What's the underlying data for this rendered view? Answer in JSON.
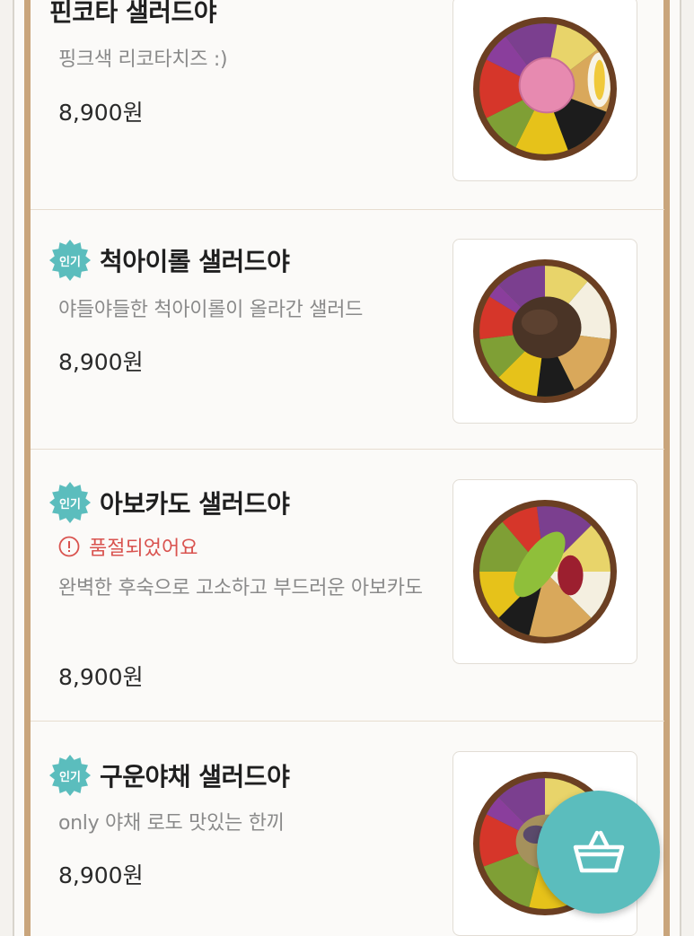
{
  "menu": {
    "items": [
      {
        "name": "핀코타 샐러드야",
        "badge": "",
        "sold_out": "",
        "desc": "핑크색 리코타치즈 :)",
        "price": "8,900원",
        "image": "salad-bowl-ricotta"
      },
      {
        "name": "척아이롤 샐러드야",
        "badge": "인기",
        "sold_out": "",
        "desc": "야들야들한 척아이롤이 올라간 샐러드",
        "price": "8,900원",
        "image": "salad-bowl-beef"
      },
      {
        "name": "아보카도 샐러드야",
        "badge": "인기",
        "sold_out": "품절되었어요",
        "desc": "완벽한 후숙으로 고소하고 부드러운 아보카도",
        "price": "8,900원",
        "image": "salad-bowl-avocado"
      },
      {
        "name": "구운야채 샐러드야",
        "badge": "인기",
        "sold_out": "",
        "desc": "only 야채 로도 맛있는 한끼",
        "price": "8,900원",
        "image": "salad-bowl-grilled-veg"
      }
    ]
  },
  "cart": {
    "icon": "basket-icon"
  },
  "colors": {
    "badge": "#5bbdbd",
    "sold_out": "#d9534f",
    "frame": "#c9a57c",
    "cart_button": "#5bbdbd",
    "divider": "#e7ddd0"
  }
}
